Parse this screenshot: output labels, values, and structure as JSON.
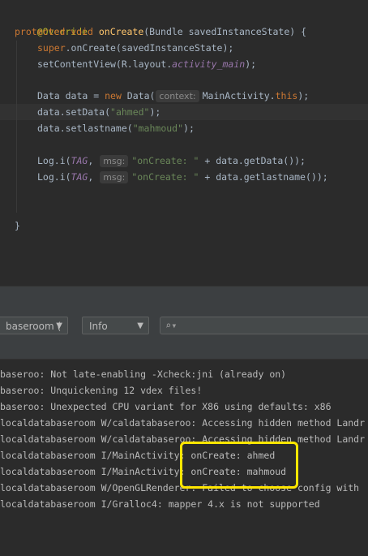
{
  "code": {
    "override": "@Override",
    "sig_kw": "protected void ",
    "sig_name": "onCreate",
    "sig_rest": "(Bundle savedInstanceState) {",
    "super_kw": "super",
    "super_rest": ".onCreate(savedInstanceState);",
    "setcv_pre": "setContentView(R.layout.",
    "setcv_field": "activity_main",
    "setcv_post": ");",
    "data_pre": "Data data = ",
    "data_new": "new",
    "data_mid": " Data(",
    "data_hint": "context:",
    "data_arg": "MainActivity.",
    "data_this": "this",
    "data_post": ");",
    "setdata_pre": "data.setData(",
    "setdata_str": "\"ahmed\"",
    "setdata_post": ");",
    "setlast_pre": "data.setlastname(",
    "setlast_str": "\"mahmoud\"",
    "setlast_post": ");",
    "log_pre": "Log.i(",
    "log_tag": "TAG",
    "log_comma": ", ",
    "log_hint": "msg:",
    "log_str": "\"onCreate: \"",
    "log1_post": " + data.getData());",
    "log2_post": " + data.getlastname());",
    "close": "}"
  },
  "logcat": {
    "process_filter": "baseroom (",
    "level_filter": "Info",
    "search_placeholder": "",
    "lines": [
      "baseroo: Not late-enabling -Xcheck:jni (already on)",
      "baseroo: Unquickening 12 vdex files!",
      "baseroo: Unexpected CPU variant for X86 using defaults: x86",
      "localdatabaseroom W/caldatabaseroo: Accessing hidden method Landr",
      "localdatabaseroom W/caldatabaseroo: Accessing hidden method Landr",
      "localdatabaseroom I/MainActivity: onCreate: ahmed",
      "localdatabaseroom I/MainActivity: onCreate: mahmoud",
      "localdatabaseroom W/OpenGLRenderer: Failed to choose config with",
      "localdatabaseroom I/Gralloc4: mapper 4.x is not supported"
    ]
  },
  "colors": {
    "highlight_box": "#ffe600",
    "editor_bg": "#2b2b2b",
    "toolbar_bg": "#3c3f41"
  }
}
